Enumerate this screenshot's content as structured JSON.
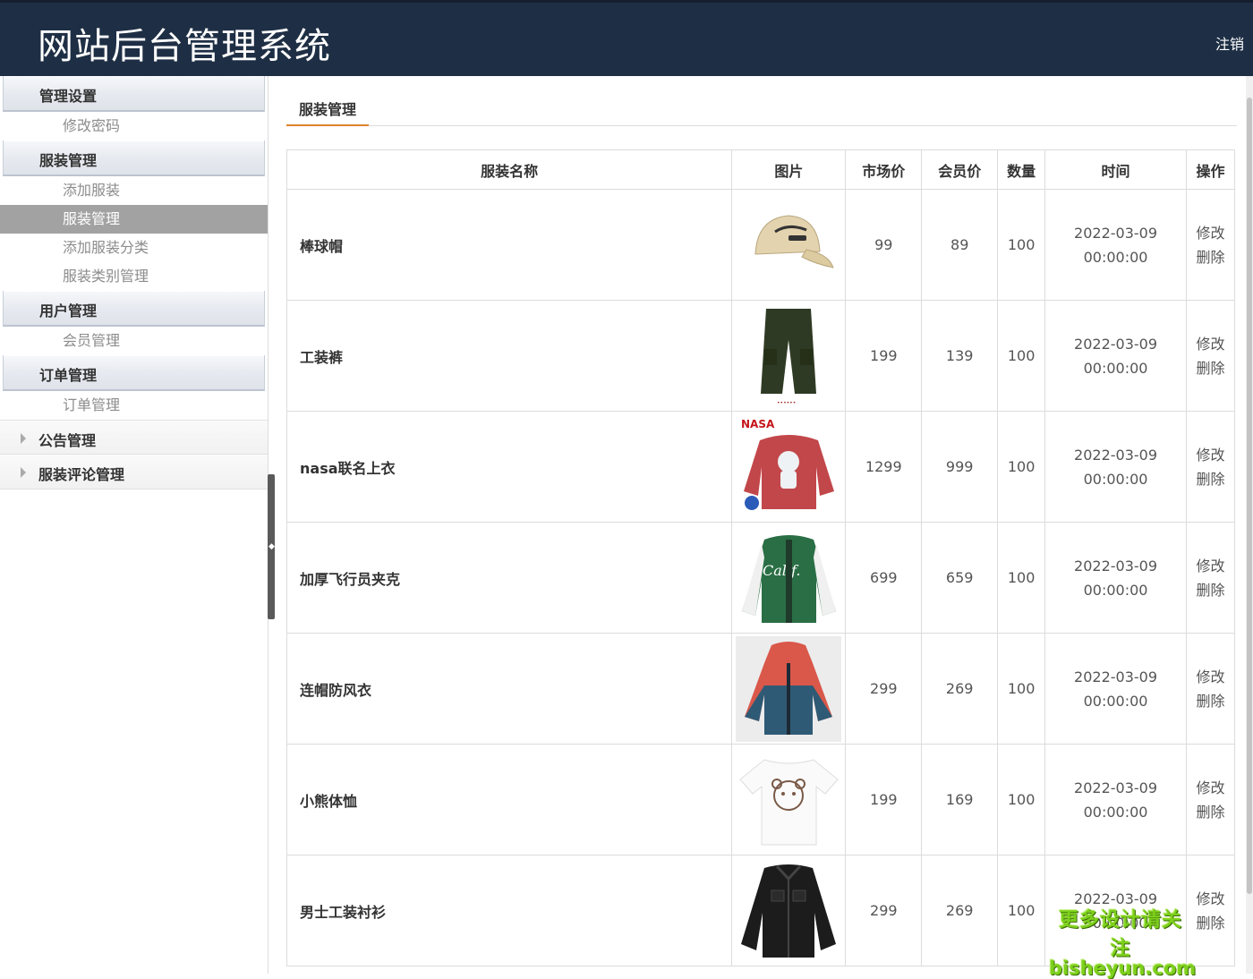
{
  "header": {
    "title": "网站后台管理系统",
    "logout_label": "注销"
  },
  "sidebar": {
    "groups": [
      {
        "label": "管理设置",
        "items": [
          "修改密码"
        ]
      },
      {
        "label": "服装管理",
        "items": [
          "添加服装",
          "服装管理",
          "添加服装分类",
          "服装类别管理"
        ]
      },
      {
        "label": "用户管理",
        "items": [
          "会员管理"
        ]
      },
      {
        "label": "订单管理",
        "items": [
          "订单管理"
        ]
      }
    ],
    "collapsed": [
      "公告管理",
      "服装评论管理"
    ],
    "active_item": "服装管理"
  },
  "tab": {
    "label": "服装管理"
  },
  "table": {
    "headers": [
      "服装名称",
      "图片",
      "市场价",
      "会员价",
      "数量",
      "时间",
      "操作"
    ],
    "rows": [
      {
        "name": "棒球帽",
        "market": "99",
        "member": "89",
        "qty": "100",
        "date": "2022-03-09",
        "time": "00:00:00",
        "icon": "baseball-cap"
      },
      {
        "name": "工装裤",
        "market": "199",
        "member": "139",
        "qty": "100",
        "date": "2022-03-09",
        "time": "00:00:00",
        "icon": "cargo-pants"
      },
      {
        "name": "nasa联名上衣",
        "market": "1299",
        "member": "999",
        "qty": "100",
        "date": "2022-03-09",
        "time": "00:00:00",
        "icon": "sweatshirt"
      },
      {
        "name": "加厚飞行员夹克",
        "market": "699",
        "member": "659",
        "qty": "100",
        "date": "2022-03-09",
        "time": "00:00:00",
        "icon": "varsity-jacket"
      },
      {
        "name": "连帽防风衣",
        "market": "299",
        "member": "269",
        "qty": "100",
        "date": "2022-03-09",
        "time": "00:00:00",
        "icon": "windbreaker"
      },
      {
        "name": "小熊体恤",
        "market": "199",
        "member": "169",
        "qty": "100",
        "date": "2022-03-09",
        "time": "00:00:00",
        "icon": "bear-tshirt"
      },
      {
        "name": "男士工装衬衫",
        "market": "299",
        "member": "269",
        "qty": "100",
        "date": "2022-03-09",
        "time": "00:00:00",
        "icon": "work-shirt"
      }
    ],
    "edit_label": "修改",
    "delete_label": "删除"
  },
  "watermark": {
    "line1": "更多设计请关注",
    "line2": "bisheyun.com"
  },
  "colors": {
    "header_bg": "#1e2f45",
    "tab_accent": "#e0832c",
    "active_item_bg": "#a2a2a2"
  }
}
